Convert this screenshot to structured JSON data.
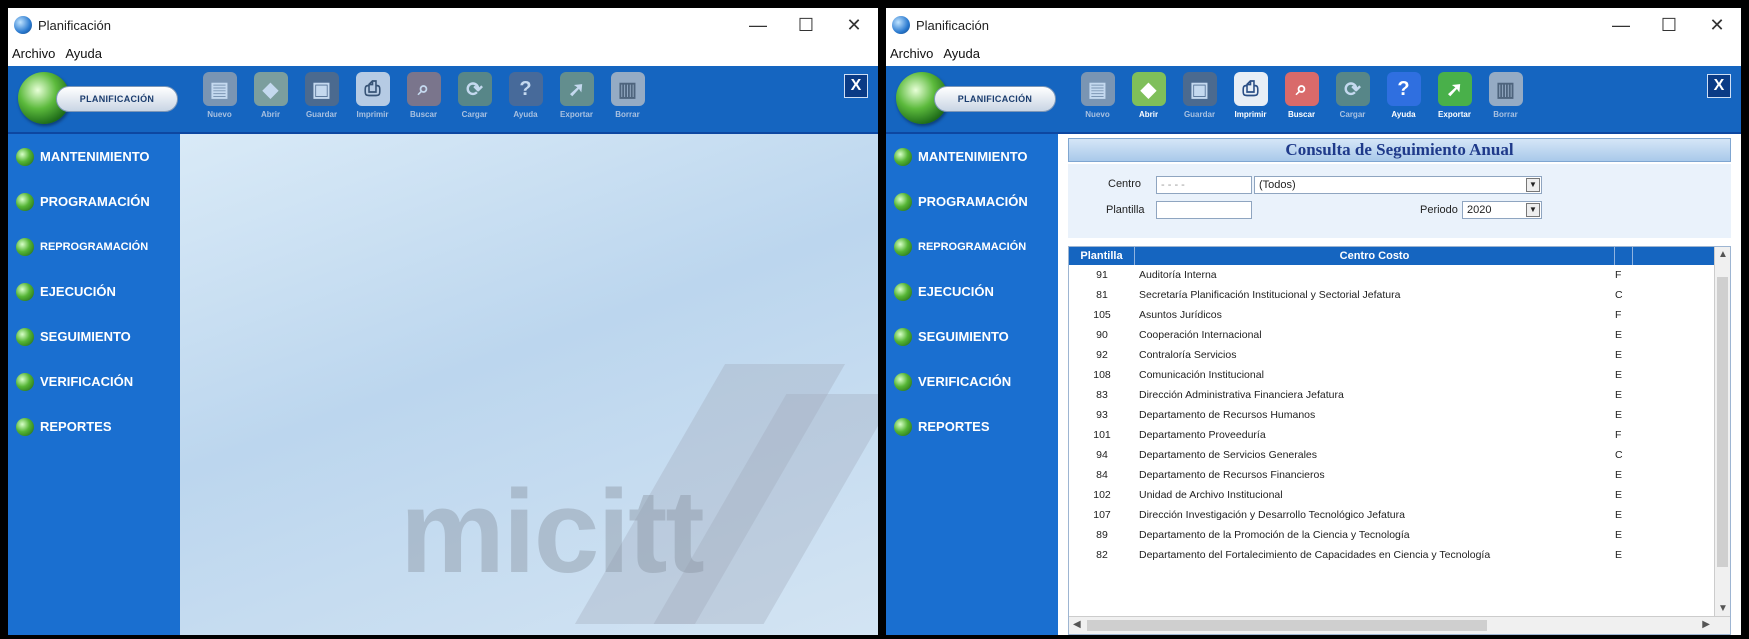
{
  "window_title": "Planificación",
  "menu": [
    "Archivo",
    "Ayuda"
  ],
  "logo_label": "PLANIFICACIÓN",
  "toolbar": [
    {
      "label": "Nuevo",
      "icon": "new-document-icon"
    },
    {
      "label": "Abrir",
      "icon": "open-icon"
    },
    {
      "label": "Guardar",
      "icon": "save-icon"
    },
    {
      "label": "Imprimir",
      "icon": "print-icon"
    },
    {
      "label": "Buscar",
      "icon": "search-icon"
    },
    {
      "label": "Cargar",
      "icon": "refresh-icon"
    },
    {
      "label": "Ayuda",
      "icon": "help-icon"
    },
    {
      "label": "Exportar",
      "icon": "export-icon"
    },
    {
      "label": "Borrar",
      "icon": "trash-icon"
    }
  ],
  "window1_enabled": [
    false,
    false,
    false,
    false,
    false,
    false,
    false,
    false,
    false
  ],
  "window2_enabled": [
    false,
    true,
    false,
    true,
    true,
    false,
    true,
    true,
    false
  ],
  "sidebar": [
    "MANTENIMIENTO",
    "PROGRAMACIÓN",
    "REPROGRAMACIÓN",
    "EJECUCIÓN",
    "SEGUIMIENTO",
    "VERIFICACIÓN",
    "REPORTES"
  ],
  "watermark": "micitt",
  "close_label": "X",
  "consulta": {
    "title": "Consulta de Seguimiento Anual",
    "centro_label": "Centro",
    "centro_code": "- - - -",
    "centro_value": "(Todos)",
    "plantilla_label": "Plantilla",
    "plantilla_value": "",
    "periodo_label": "Periodo",
    "periodo_value": "2020",
    "columns": [
      "Plantilla",
      "Centro Costo"
    ],
    "rows": [
      {
        "plantilla": "91",
        "centro": "Auditoría Interna",
        "extra": "F"
      },
      {
        "plantilla": "81",
        "centro": "Secretaría Planificación Institucional y Sectorial Jefatura",
        "extra": "C"
      },
      {
        "plantilla": "105",
        "centro": "Asuntos Jurídicos",
        "extra": "F"
      },
      {
        "plantilla": "90",
        "centro": "Cooperación Internacional",
        "extra": "E"
      },
      {
        "plantilla": "92",
        "centro": "Contraloría Servicios",
        "extra": "E"
      },
      {
        "plantilla": "108",
        "centro": "Comunicación Institucional",
        "extra": "E"
      },
      {
        "plantilla": "83",
        "centro": "Dirección Administrativa Financiera Jefatura",
        "extra": "E"
      },
      {
        "plantilla": "93",
        "centro": "Departamento de Recursos Humanos",
        "extra": "E"
      },
      {
        "plantilla": "101",
        "centro": "Departamento Proveeduría",
        "extra": "F"
      },
      {
        "plantilla": "94",
        "centro": "Departamento de Servicios Generales",
        "extra": "C"
      },
      {
        "plantilla": "84",
        "centro": "Departamento de Recursos Financieros",
        "extra": "E"
      },
      {
        "plantilla": "102",
        "centro": "Unidad de Archivo Institucional",
        "extra": "E"
      },
      {
        "plantilla": "107",
        "centro": "Dirección Investigación y Desarrollo Tecnológico Jefatura",
        "extra": "E"
      },
      {
        "plantilla": "89",
        "centro": "Departamento de la Promoción de la Ciencia y Tecnología",
        "extra": "E"
      },
      {
        "plantilla": "82",
        "centro": "Departamento del Fortalecimiento de Capacidades en Ciencia y Tecnología",
        "extra": "E"
      }
    ]
  }
}
